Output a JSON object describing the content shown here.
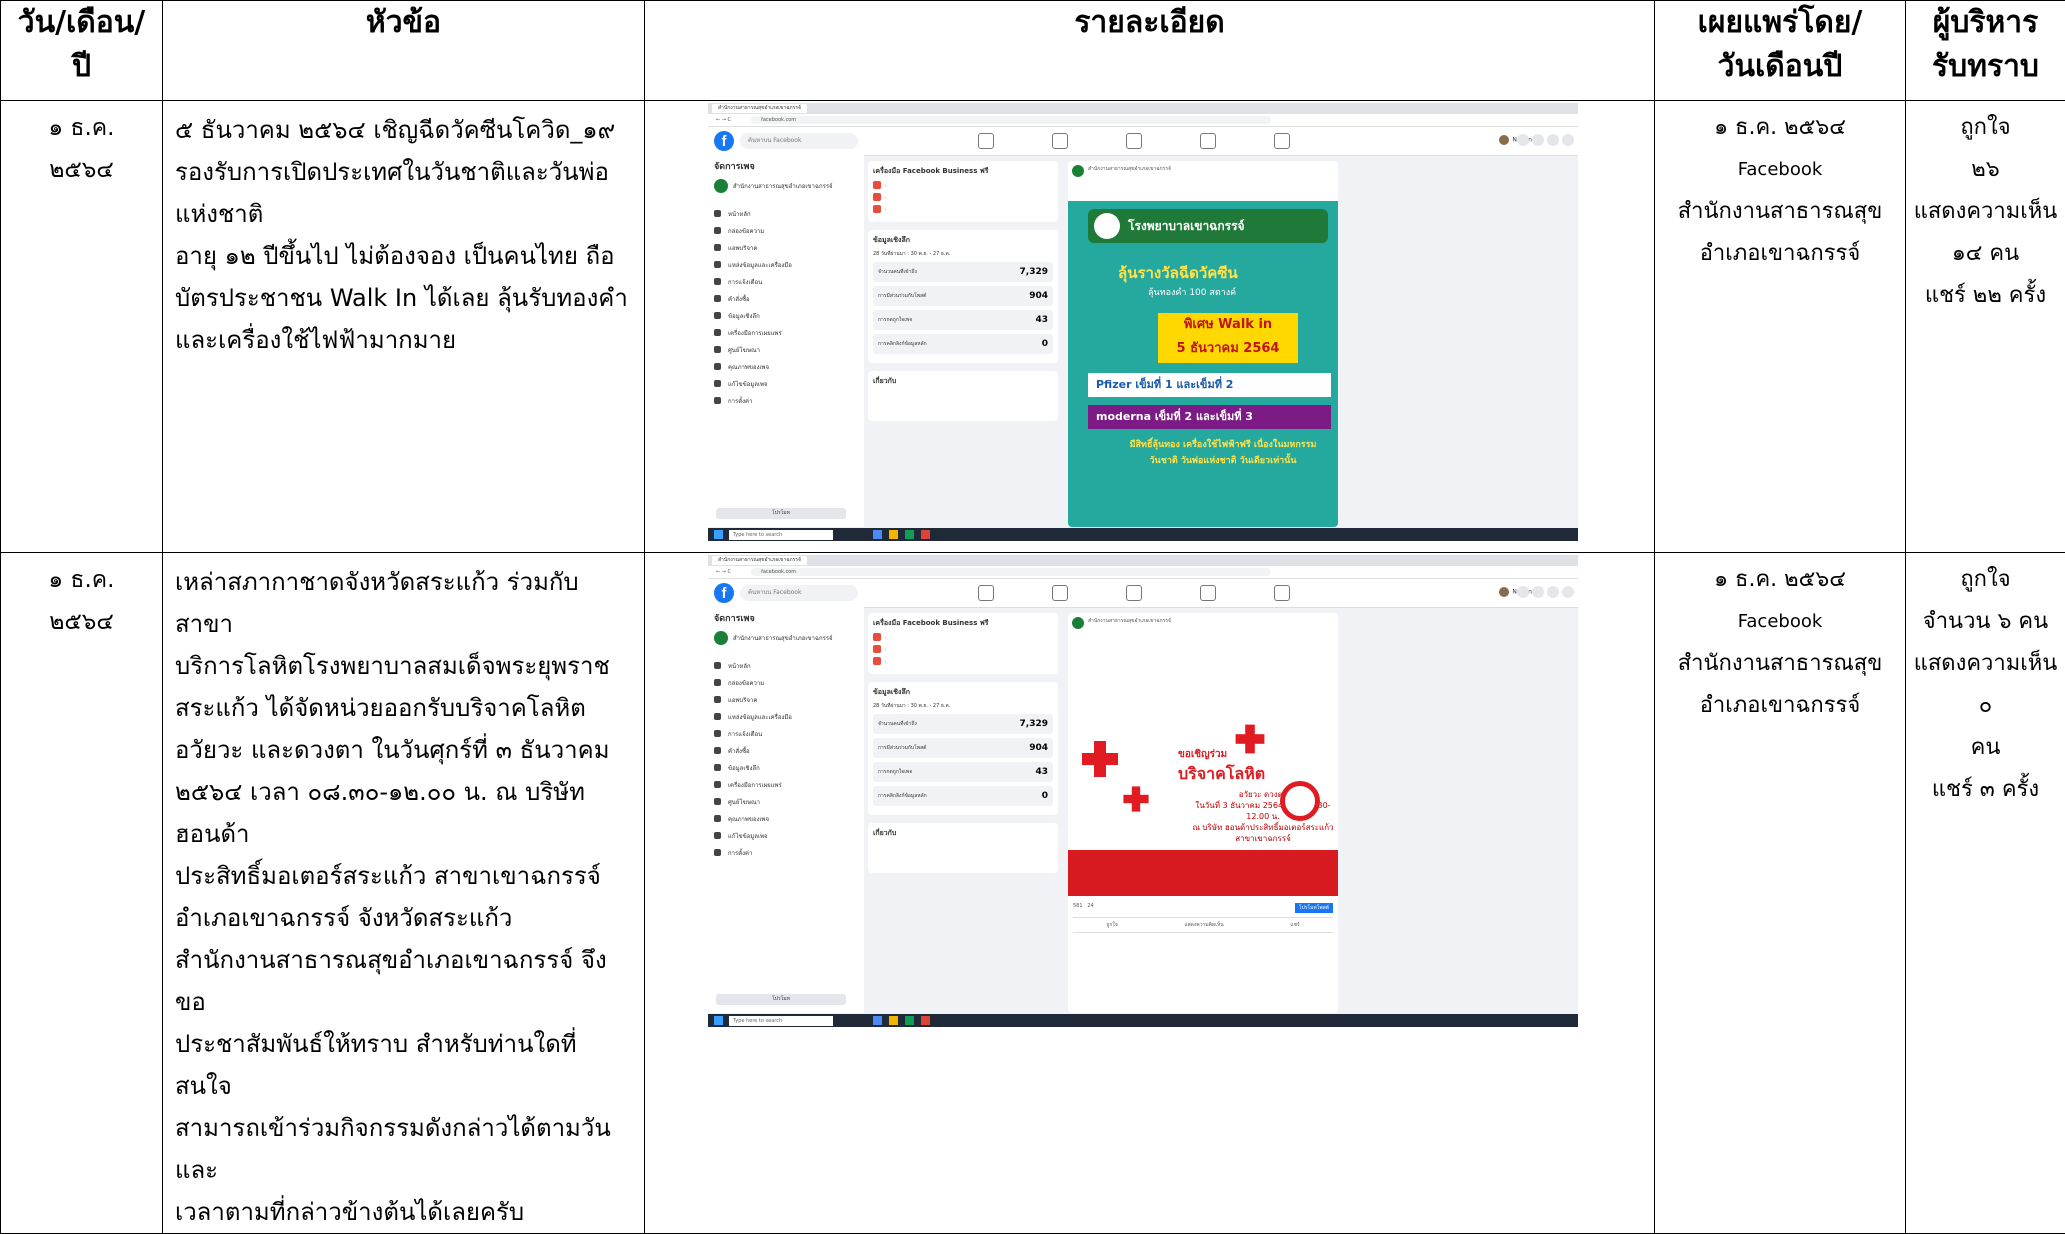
{
  "header": {
    "date_col": [
      "วัน/เดือน/",
      "ปี"
    ],
    "topic_col": [
      "หัวข้อ"
    ],
    "detail_col": [
      "รายละเอียด"
    ],
    "publisher_col": [
      "เผยแพร่โดย/",
      "วันเดือนปี"
    ],
    "executive_col": [
      "ผู้บริหาร",
      "รับทราบ"
    ]
  },
  "rows": [
    {
      "date": [
        "๑ ธ.ค.",
        "๒๕๖๔"
      ],
      "topic": [
        "๕ ธันวาคม ๒๕๖๔ เชิญฉีดวัคซีนโควิด_๑๙",
        "รองรับการเปิดประเทศในวันชาติและวันพ่อ",
        "แห่งชาติ",
        "อายุ ๑๒ ปีขึ้นไป ไม่ต้องจอง เป็นคนไทย ถือ",
        "บัตรประชาชน Walk In ได้เลย ลุ้นรับทองคำ",
        "และเครื่องใช้ไฟฟ้ามากมาย"
      ],
      "publisher": [
        "๑ ธ.ค. ๒๕๖๔",
        "Facebook",
        "สำนักงานสาธารณสุข",
        "อำเภอเขาฉกรรจ์"
      ],
      "executive": [
        "ถูกใจ",
        "๒๖",
        "แสดงความเห็น",
        "๑๔ คน",
        "แชร์ ๒๒ ครั้ง"
      ],
      "shot": {
        "search_placeholder": "ค้นหาบน Facebook",
        "user": "Nongnet",
        "manage": "จัดการเพจ",
        "page_name": "สำนักงานสาธารณสุขอำเภอเขาฉกรรจ์",
        "tools_title": "เครื่องมือ Facebook Business ฟรี",
        "insights_title": "ข้อมูลเชิงลึก",
        "range": "28 วันที่ผ่านมา : 30 พ.ย. - 27 ธ.ค.",
        "stats": [
          {
            "label": "จำนวนคนที่เข้าถึง",
            "value": "7,329"
          },
          {
            "label": "การมีส่วนร่วมกับโพสต์",
            "value": "904"
          },
          {
            "label": "การกดถูกใจเพจ",
            "value": "43"
          },
          {
            "label": "การคลิกลิงก์ข้อมูลหลัก",
            "value": "0"
          }
        ],
        "about": "เกี่ยวกับ",
        "nav": [
          "หน้าหลัก",
          "กล่องข้อความ",
          "แอพบริจาค",
          "แหล่งข้อมูลและเครื่องมือ",
          "การแจ้งเตือน",
          "คำสั่งซื้อ",
          "ข้อมูลเชิงลึก",
          "เครื่องมือการเผยแพร่",
          "ศูนย์โฆษณา",
          "คุณภาพของเพจ",
          "แก้ไขข้อมูลเพจ",
          "การตั้งค่า"
        ],
        "promote": "โปรโมท",
        "poster_hospital": "โรงพยาบาลเขาฉกรรจ์",
        "poster_line1": "ลุ้นรางวัลฉีดวัคซีน",
        "poster_line2": "ลุ้นทองคำ 100 สตางค์",
        "poster_walk": "พิเศษ Walk in",
        "poster_date": "5 ธันวาคม 2564",
        "poster_pfizer": "Pfizer เข็มที่ 1 และเข็มที่ 2",
        "poster_moderna": "moderna เข็มที่ 2 และเข็มที่ 3",
        "poster_gift": "มีสิทธิ์ลุ้นทอง เครื่องใช้ไฟฟ้าฟรี เนื่องในมหกรรมวันชาติ วันพ่อแห่งชาติ วันเดียวเท่านั้น",
        "taskbar_search": "Type here to search"
      }
    },
    {
      "date": [
        "๑ ธ.ค.",
        "๒๕๖๔"
      ],
      "topic": [
        "เหล่าสภากาชาดจังหวัดสระแก้ว ร่วมกับสาขา",
        "บริการโลหิตโรงพยาบาลสมเด็จพระยุพราช",
        "สระแก้ว ได้จัดหน่วยออกรับบริจาคโลหิต",
        "อวัยวะ และดวงตา ในวันศุกร์ที่ ๓ ธันวาคม",
        "๒๕๖๔ เวลา ๐๘.๓๐-๑๒.๐๐ น. ณ บริษัท ฮอนด้า",
        "ประสิทธิ์มอเตอร์สระแก้ว สาขาเขาฉกรรจ์",
        "อำเภอเขาฉกรรจ์ จังหวัดสระแก้ว",
        "สำนักงานสาธารณสุขอำเภอเขาฉกรรจ์ จึงขอ",
        "ประชาสัมพันธ์ให้ทราบ สำหรับท่านใดที่ สนใจ",
        "สามารถเข้าร่วมกิจกรรมดังกล่าวได้ตามวันและ",
        "เวลาตามที่กล่าวข้างต้นได้เลยครับ"
      ],
      "publisher": [
        "๑ ธ.ค. ๒๕๖๔",
        "Facebook",
        "สำนักงานสาธารณสุข",
        "อำเภอเขาฉกรรจ์"
      ],
      "executive": [
        "ถูกใจ",
        "จำนวน ๖ คน",
        "แสดงความเห็น ๐",
        "คน",
        "แชร์ ๓ ครั้ง"
      ],
      "shot": {
        "search_placeholder": "ค้นหาบน Facebook",
        "user": "Nongnet",
        "manage": "จัดการเพจ",
        "page_name": "สำนักงานสาธารณสุขอำเภอเขาฉกรรจ์",
        "tools_title": "เครื่องมือ Facebook Business ฟรี",
        "insights_title": "ข้อมูลเชิงลึก",
        "range": "28 วันที่ผ่านมา : 30 พ.ย. - 27 ธ.ค.",
        "stats": [
          {
            "label": "จำนวนคนที่เข้าถึง",
            "value": "7,329"
          },
          {
            "label": "การมีส่วนร่วมกับโพสต์",
            "value": "904"
          },
          {
            "label": "การกดถูกใจเพจ",
            "value": "43"
          },
          {
            "label": "การคลิกลิงก์ข้อมูลหลัก",
            "value": "0"
          }
        ],
        "about": "เกี่ยวกับ",
        "nav": [
          "หน้าหลัก",
          "กล่องข้อความ",
          "แอพบริจาค",
          "แหล่งข้อมูลและเครื่องมือ",
          "การแจ้งเตือน",
          "คำสั่งซื้อ",
          "ข้อมูลเชิงลึก",
          "เครื่องมือการเผยแพร่",
          "ศูนย์โฆษณา",
          "คุณภาพของเพจ",
          "แก้ไขข้อมูลเพจ",
          "การตั้งค่า"
        ],
        "promote": "โปรโมท",
        "poster_title": "บริจาคโลหิต",
        "poster_invite": "ขอเชิญร่วม",
        "poster_sub": "อวัยวะ ดวงตา",
        "poster_when": "ในวันที่ 3 ธันวาคม 2564 เวลา 08.30-12.00 น.",
        "poster_where": "ณ บริษัท ฮอนด้าประสิทธิ์มอเตอร์สระแก้ว สาขาเขาฉกรรจ์",
        "reach": "581",
        "engage": "24",
        "boost": "โปรโมทโพสต์",
        "actions": [
          "ถูกใจ",
          "แสดงความคิดเห็น",
          "แชร์"
        ],
        "taskbar_search": "Type here to search"
      }
    }
  ]
}
